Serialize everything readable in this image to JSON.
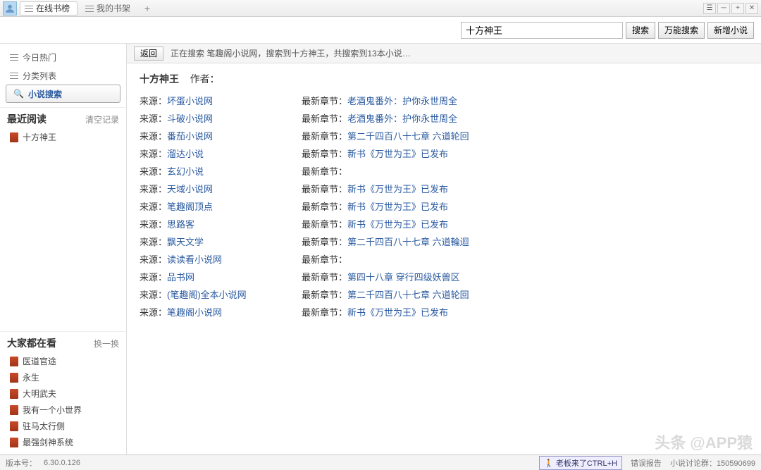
{
  "titlebar": {
    "tabs": [
      {
        "label": "在线书榜",
        "active": true
      },
      {
        "label": "我的书架",
        "active": false
      }
    ],
    "add": "+"
  },
  "search": {
    "input_value": "十方神王",
    "btn_search": "搜索",
    "btn_universal": "万能搜索",
    "btn_newnovel": "新增小说"
  },
  "sidebar": {
    "nav": [
      {
        "label": "今日热门"
      },
      {
        "label": "分类列表"
      }
    ],
    "search_label": "小说搜索",
    "recent": {
      "title": "最近阅读",
      "action": "清空记录",
      "items": [
        "十方神王"
      ]
    },
    "popular": {
      "title": "大家都在看",
      "action": "换一换",
      "items": [
        "医道官途",
        "永生",
        "大明武夫",
        "我有一个小世界",
        "驻马太行侧",
        "最强剑神系统"
      ]
    }
  },
  "results": {
    "back": "返回",
    "status": "正在搜索 笔趣阁小说网，搜索到十方神王，共搜索到13本小说…",
    "book_title": "十方神王",
    "author_label": "作者：",
    "source_label": "来源：",
    "chapter_label": "最新章节：",
    "rows": [
      {
        "source": "坏蛋小说网",
        "chapter": "老酒鬼番外：护你永世周全"
      },
      {
        "source": "斗破小说网",
        "chapter": "老酒鬼番外：护你永世周全"
      },
      {
        "source": "番茄小说网",
        "chapter": "第二千四百八十七章 六道轮回"
      },
      {
        "source": "溜达小说",
        "chapter": "新书《万世为王》已发布"
      },
      {
        "source": "玄幻小说",
        "chapter": ""
      },
      {
        "source": "天域小说网",
        "chapter": "新书《万世为王》已发布"
      },
      {
        "source": "笔趣阁顶点",
        "chapter": "新书《万世为王》已发布"
      },
      {
        "source": "思路客",
        "chapter": "新书《万世为王》已发布"
      },
      {
        "source": "飘天文学",
        "chapter": "第二千四百八十七章 六道輪迴"
      },
      {
        "source": "读读看小说网",
        "chapter": ""
      },
      {
        "source": "品书网",
        "chapter": "第四十八章 穿行四级妖兽区"
      },
      {
        "source": "(笔趣阁)全本小说网",
        "chapter": "第二千四百八十七章 六道轮回"
      },
      {
        "source": "笔趣阁小说网",
        "chapter": "新书《万世为王》已发布"
      }
    ]
  },
  "statusbar": {
    "version_label": "版本号：",
    "version": "6.30.0.126",
    "boss": "老板来了CTRL+H",
    "errreport": "错误报告",
    "group_label": "小说讨论群：",
    "group": "150590699"
  },
  "watermark": {
    "main": "头条 @APP猿"
  }
}
